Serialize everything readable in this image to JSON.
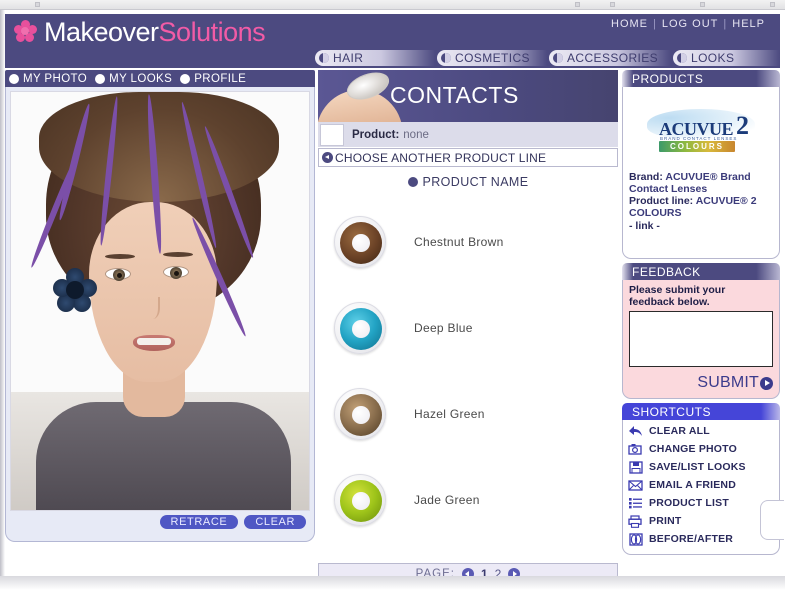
{
  "header": {
    "logo_primary": "Makeover",
    "logo_secondary": "Solutions",
    "logo_icon": "flower-icon",
    "links": [
      {
        "label": "HOME"
      },
      {
        "label": "LOG OUT"
      },
      {
        "label": "HELP"
      }
    ],
    "separator": "|"
  },
  "nav": {
    "tabs": [
      {
        "label": "HAIR",
        "id": "hair"
      },
      {
        "label": "COSMETICS",
        "id": "cosmetics"
      },
      {
        "label": "ACCESSORIES",
        "id": "accessories"
      },
      {
        "label": "LOOKS",
        "id": "looks"
      }
    ]
  },
  "left_panel": {
    "tabs": [
      {
        "label": "MY PHOTO"
      },
      {
        "label": "MY LOOKS"
      },
      {
        "label": "PROFILE"
      }
    ],
    "buttons": [
      {
        "label": "RETRACE",
        "name": "retrace-button"
      },
      {
        "label": "CLEAR",
        "name": "clear-button"
      }
    ]
  },
  "center_panel": {
    "banner_title": "CONTACTS",
    "product_label": "Product:",
    "product_value": "none",
    "choose_another": "CHOOSE ANOTHER PRODUCT LINE",
    "column_header": "PRODUCT NAME",
    "items": [
      {
        "name": "Chestnut Brown",
        "ring_color": "#6b4226",
        "ring_color2": "#8a5a33"
      },
      {
        "name": "Deep Blue",
        "ring_color": "#1e8fb0",
        "ring_color2": "#35b6d6"
      },
      {
        "name": "Hazel Green",
        "ring_color": "#8b6f4e",
        "ring_color2": "#a98a63"
      },
      {
        "name": "Jade Green",
        "ring_color": "#8fb913",
        "ring_color2": "#b9d23a"
      }
    ]
  },
  "pager": {
    "label": "PAGE:",
    "prev_icon": "arrow-left-icon",
    "next_icon": "arrow-right-icon",
    "pages": [
      {
        "num": "1",
        "current": true
      },
      {
        "num": "2",
        "current": false
      }
    ],
    "separator": "|"
  },
  "right_panel": {
    "products": {
      "title": "PRODUCTS",
      "logo_word": "ACUVUE",
      "logo_two": "2",
      "logo_sub": "BRAND CONTACT LENSES",
      "logo_colours": "COLOURS",
      "brand_label": "Brand:",
      "brand_value": "ACUVUE® Brand Contact Lenses",
      "line_label": "Product line:",
      "line_value": "ACUVUE® 2 COLOURS",
      "link_text": "- link -"
    },
    "feedback": {
      "title": "FEEDBACK",
      "prompt": "Please submit your feedback below.",
      "textarea_value": "",
      "textarea_placeholder": "",
      "submit_label": "SUBMIT"
    },
    "shortcuts": {
      "title": "SHORTCUTS",
      "items": [
        {
          "label": "CLEAR ALL",
          "icon": "undo-arrow-icon"
        },
        {
          "label": "CHANGE PHOTO",
          "icon": "camera-icon"
        },
        {
          "label": "SAVE/LIST LOOKS",
          "icon": "floppy-disk-icon"
        },
        {
          "label": "EMAIL A FRIEND",
          "icon": "envelope-icon"
        },
        {
          "label": "PRODUCT LIST",
          "icon": "list-icon"
        },
        {
          "label": "PRINT",
          "icon": "printer-icon"
        },
        {
          "label": "BEFORE/AFTER",
          "icon": "before-after-icon"
        }
      ]
    }
  },
  "colors": {
    "header_purple": "#4c4a80",
    "accent_pink": "#f25ba6",
    "shortcut_blue": "#4545d8",
    "feedback_pink": "#fbd9dd",
    "button_blue": "#4f57c4"
  }
}
